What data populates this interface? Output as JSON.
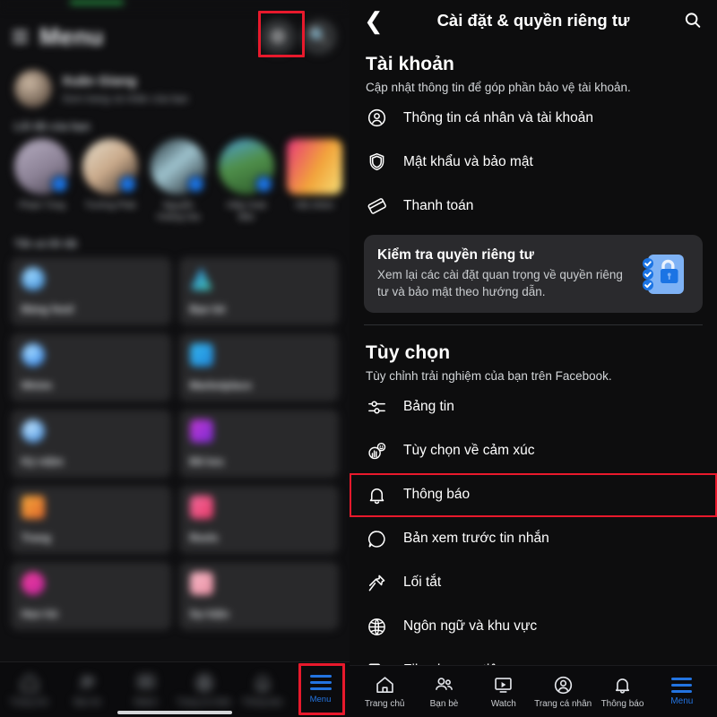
{
  "left_panel": {
    "header": {
      "title": "Menu",
      "hamburger_icon": "hamburger-icon",
      "gear_icon": "gear-icon",
      "search_icon": "search-icon"
    },
    "profile": {
      "name": "Xuân Giang",
      "subtitle": "Xem trang cá nhân của bạn"
    },
    "stories_label": "Lối tắt của bạn",
    "stories": [
      {
        "name": "Phạm Tùng"
      },
      {
        "name": "Trường Phát"
      },
      {
        "name": "Nguyễn Hoàng Gia"
      },
      {
        "name": "Hiệp Hoài Bão"
      },
      {
        "name": "Hội nhóm"
      }
    ],
    "all_label": "Tất cả lối tắt",
    "tiles": [
      {
        "label": "Bảng feed",
        "icon": "feed-icon"
      },
      {
        "label": "Bạn bè",
        "icon": "friends-icon"
      },
      {
        "label": "Nhóm",
        "icon": "groups-icon"
      },
      {
        "label": "Marketplace",
        "icon": "marketplace-icon"
      },
      {
        "label": "Kỷ niệm",
        "icon": "memories-icon"
      },
      {
        "label": "Đã lưu",
        "icon": "saved-icon"
      },
      {
        "label": "Trang",
        "icon": "pages-icon"
      },
      {
        "label": "Reels",
        "icon": "reels-icon"
      },
      {
        "label": "Hẹn hò",
        "icon": "dating-icon"
      },
      {
        "label": "Sự kiện",
        "icon": "events-icon"
      }
    ],
    "bottom_nav": [
      {
        "label": "Trang chủ",
        "icon": "home-icon",
        "active": false
      },
      {
        "label": "Bạn bè",
        "icon": "friends-icon",
        "active": false
      },
      {
        "label": "Watch",
        "icon": "watch-icon",
        "active": false
      },
      {
        "label": "Trang cá nhân",
        "icon": "profile-icon",
        "active": false
      },
      {
        "label": "Thông báo",
        "icon": "bell-icon",
        "active": false
      },
      {
        "label": "Menu",
        "icon": "hamburger-icon",
        "active": true
      }
    ]
  },
  "right_panel": {
    "header": {
      "back_icon": "back-chevron-icon",
      "title": "Cài đặt & quyền riêng tư",
      "search_icon": "search-icon"
    },
    "account_section": {
      "heading": "Tài khoản",
      "description": "Cập nhật thông tin để góp phần bảo vệ tài khoản.",
      "items": [
        {
          "label": "Thông tin cá nhân và tài khoản",
          "icon": "person-circle-icon"
        },
        {
          "label": "Mật khẩu và bảo mật",
          "icon": "shield-icon"
        },
        {
          "label": "Thanh toán",
          "icon": "card-icon"
        }
      ]
    },
    "privacy_checkup": {
      "title": "Kiểm tra quyền riêng tư",
      "description": "Xem lại các cài đặt quan trọng về quyền riêng tư và bảo mật theo hướng dẫn.",
      "icon": "privacy-checklist-lock-icon"
    },
    "preferences_section": {
      "heading": "Tùy chọn",
      "description": "Tùy chỉnh trải nghiệm của bạn trên Facebook.",
      "items": [
        {
          "label": "Bảng tin",
          "icon": "sliders-icon",
          "highlighted": false
        },
        {
          "label": "Tùy chọn về cảm xúc",
          "icon": "reactions-icon",
          "highlighted": false
        },
        {
          "label": "Thông báo",
          "icon": "bell-icon",
          "highlighted": true
        },
        {
          "label": "Bản xem trước tin nhắn",
          "icon": "message-preview-icon",
          "highlighted": false
        },
        {
          "label": "Lối tắt",
          "icon": "pin-icon",
          "highlighted": false
        },
        {
          "label": "Ngôn ngữ và khu vực",
          "icon": "globe-icon",
          "highlighted": false
        },
        {
          "label": "File phương tiện",
          "icon": "media-icon",
          "highlighted": false
        }
      ]
    },
    "bottom_nav": [
      {
        "label": "Trang chủ",
        "icon": "home-icon",
        "active": false
      },
      {
        "label": "Bạn bè",
        "icon": "friends-icon",
        "active": false
      },
      {
        "label": "Watch",
        "icon": "watch-icon",
        "active": false
      },
      {
        "label": "Trang cá nhân",
        "icon": "profile-icon",
        "active": false
      },
      {
        "label": "Thông báo",
        "icon": "bell-icon",
        "active": false
      },
      {
        "label": "Menu",
        "icon": "hamburger-icon",
        "active": true
      }
    ]
  },
  "colors": {
    "background": "#0d0d0e",
    "card": "#2a2a2d",
    "accent_blue": "#2374e1",
    "highlight_red": "#e8192c",
    "icon_light_blue": "#7eb2f5",
    "lock_blue": "#1b74e4"
  }
}
